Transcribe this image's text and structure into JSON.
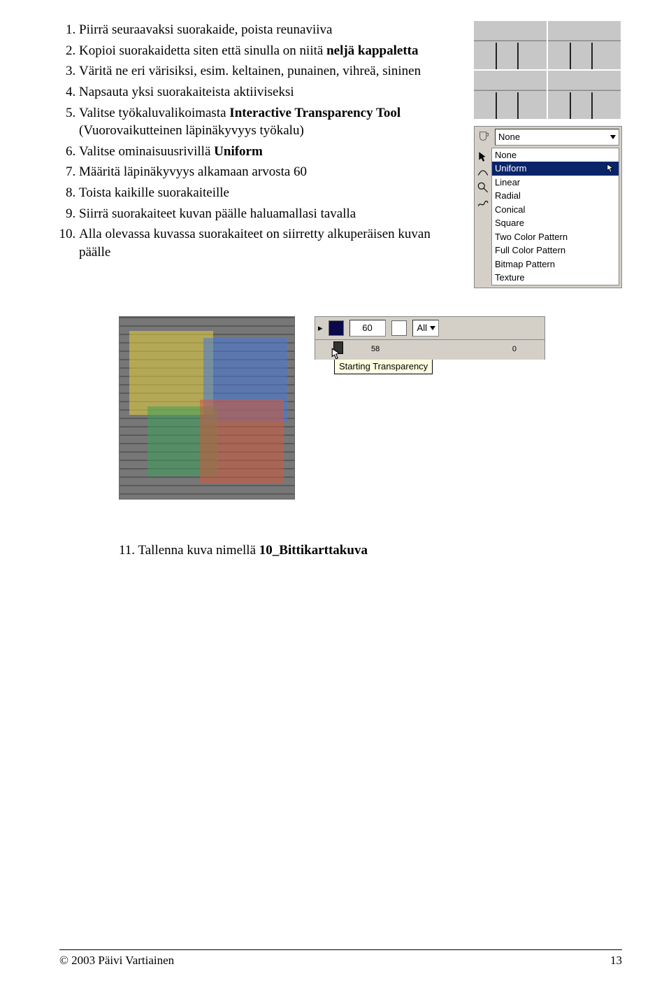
{
  "instructions": {
    "i1a": "Piirrä seuraavaksi suorakaide, poista reunaviiva",
    "i2a": "Kopioi suorakaidetta siten että sinulla on niitä ",
    "i2b": "neljä kappaletta",
    "i3": "Väritä ne eri värisiksi, esim. keltainen, punainen, vihreä, sininen",
    "i4": "Napsauta yksi suorakaiteista aktiiviseksi",
    "i5a": "Valitse työkaluvalikoimasta ",
    "i5b": "Interactive Transparency Tool",
    "i5c": " (Vuorovaikutteinen läpinäkyvyys työkalu)",
    "i6a": "Valitse ominaisuusrivillä ",
    "i6b": "Uniform",
    "i7": "Määritä läpinäkyvyys alkamaan arvosta 60",
    "i8": "Toista kaikille suorakaiteille",
    "i9": "Siirrä suorakaiteet kuvan päälle haluamallasi tavalla",
    "i10": "Alla olevassa kuvassa suorakaiteet on siirretty alkuperäisen kuvan päälle"
  },
  "dropdown": {
    "selected_top": "None",
    "options": [
      "None",
      "Uniform",
      "Linear",
      "Radial",
      "Conical",
      "Square",
      "Two Color Pattern",
      "Full Color Pattern",
      "Bitmap Pattern",
      "Texture"
    ]
  },
  "slider": {
    "value": "60",
    "tick_near": "58",
    "tick_zero": "0",
    "mode": "All",
    "tooltip": "Starting Transparency"
  },
  "save": {
    "prefix": "11. ",
    "text": "Tallenna kuva nimellä ",
    "bold": "10_Bittikarttakuva"
  },
  "footer": {
    "left": "© 2003 Päivi Vartiainen",
    "right": "13"
  }
}
